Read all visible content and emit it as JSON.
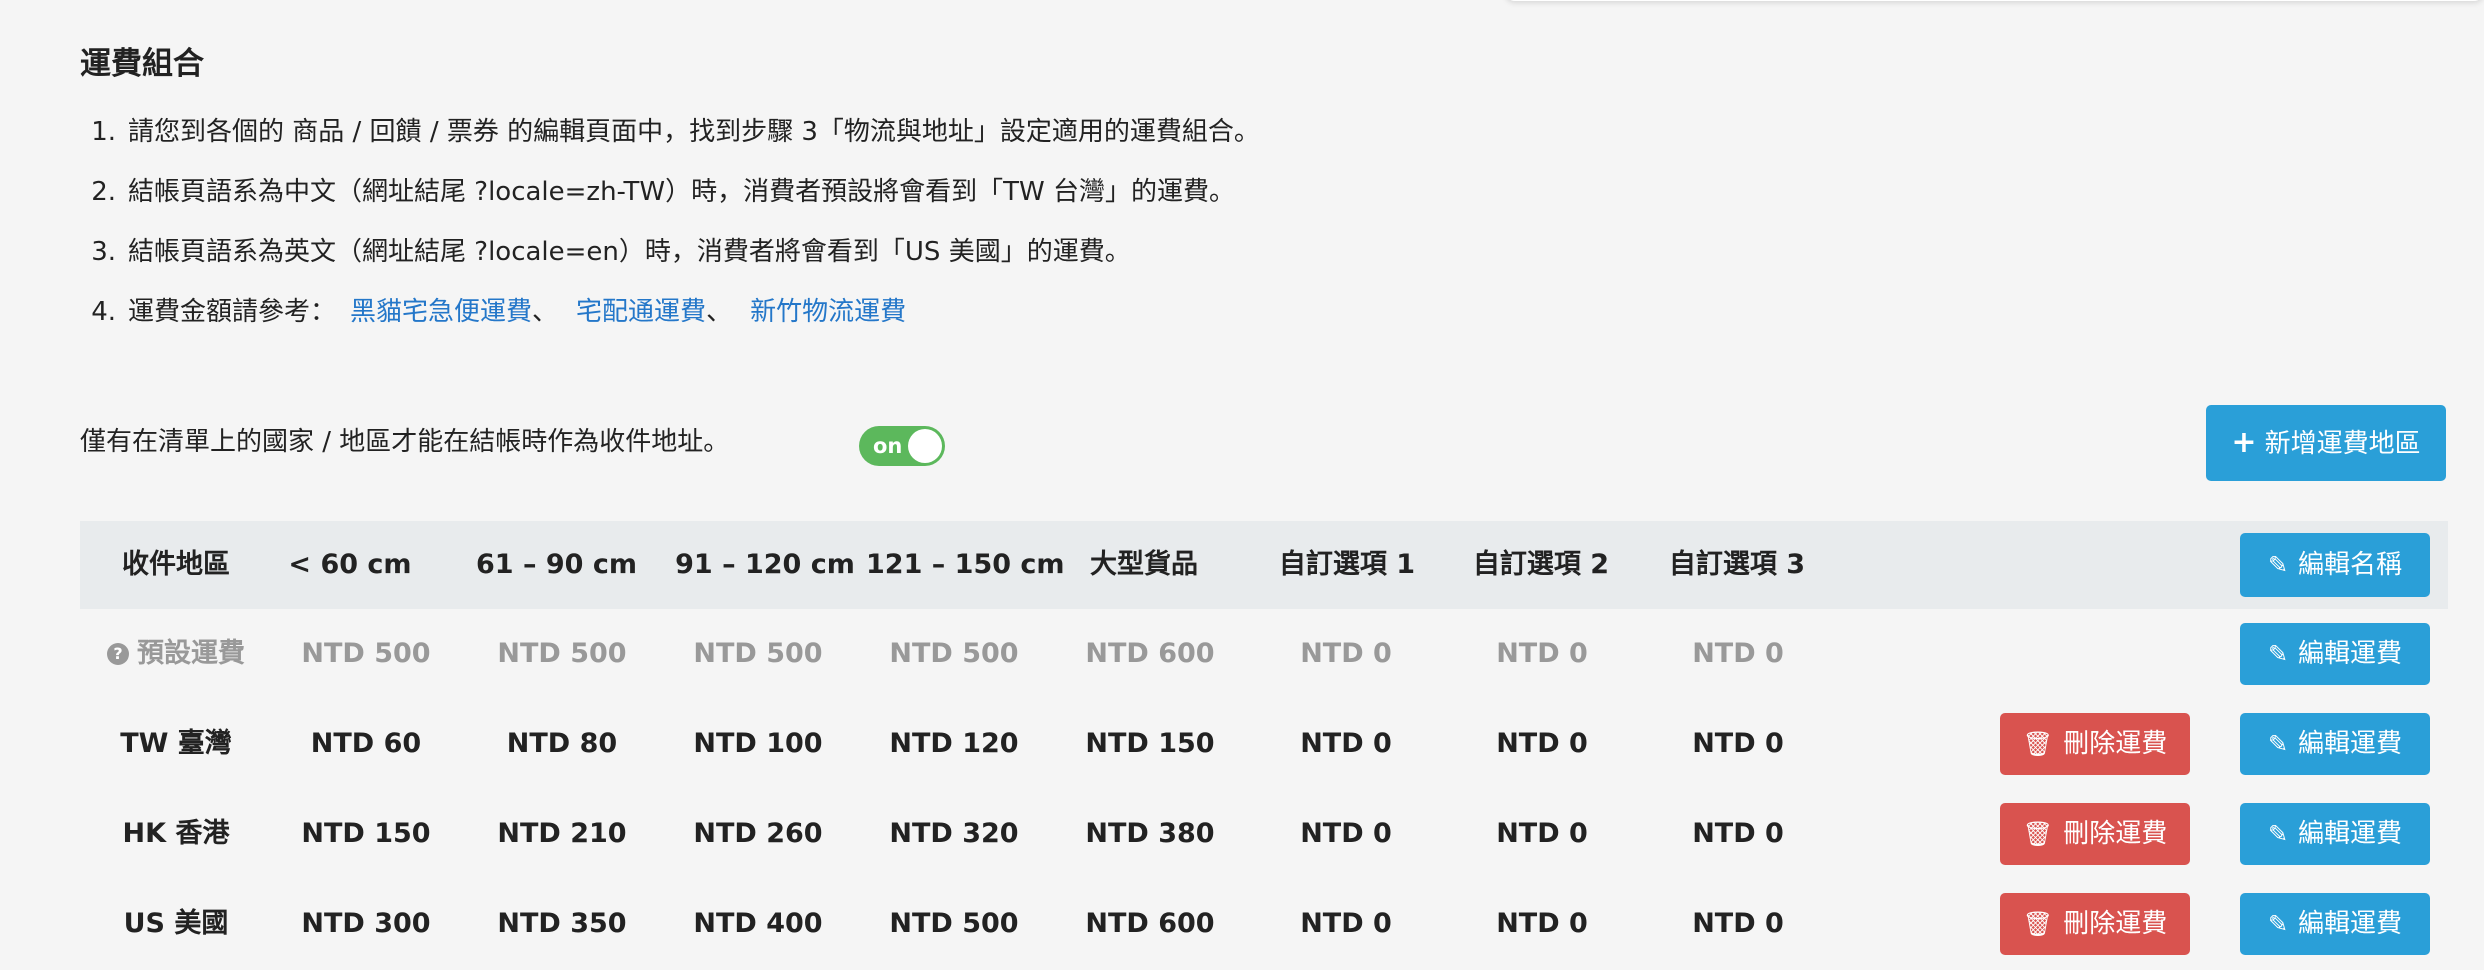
{
  "section": {
    "title": "運費組合",
    "instructions": [
      {
        "num": "1.",
        "text": "請您到各個的 商品 / 回饋 / 票券 的編輯頁面中，找到步驟 3「物流與地址」設定適用的運費組合。"
      },
      {
        "num": "2.",
        "text": "結帳頁語系為中文（網址結尾 ?locale=zh-TW）時，消費者預設將會看到「TW 台灣」的運費。"
      },
      {
        "num": "3.",
        "text": "結帳頁語系為英文（網址結尾 ?locale=en）時，消費者將會看到「US 美國」的運費。"
      }
    ],
    "reference": {
      "num": "4.",
      "prefix": "運費金額請參考：",
      "links": [
        "黑貓宅急便運費",
        "宅配通運費",
        "新竹物流運費"
      ],
      "separator": "、"
    }
  },
  "restriction": {
    "text": "僅有在清單上的國家 / 地區才能在結帳時作為收件地址。",
    "toggle_label": "on",
    "toggle_state": "on",
    "toggle_color": "#5cb85c"
  },
  "add_region_button": {
    "icon": "plus-icon",
    "label": "新增運費地區"
  },
  "table": {
    "headers": [
      "收件地區",
      "< 60 cm",
      "61 – 90 cm",
      "91 – 120 cm",
      "121 – 150 cm",
      "大型貨品",
      "自訂選項 1",
      "自訂選項 2",
      "自訂選項 3"
    ],
    "edit_names_label": "編輯名稱",
    "edit_fee_label": "編輯運費",
    "delete_fee_label": "刪除運費",
    "default_row": {
      "region": "預設運費",
      "icon": "question-circle-icon",
      "values": [
        "NTD 500",
        "NTD 500",
        "NTD 500",
        "NTD 500",
        "NTD 600",
        "NTD 0",
        "NTD 0",
        "NTD 0"
      ]
    },
    "rows": [
      {
        "region": "TW 臺灣",
        "values": [
          "NTD 60",
          "NTD 80",
          "NTD 100",
          "NTD 120",
          "NTD 150",
          "NTD 0",
          "NTD 0",
          "NTD 0"
        ]
      },
      {
        "region": "HK 香港",
        "values": [
          "NTD 150",
          "NTD 210",
          "NTD 260",
          "NTD 320",
          "NTD 380",
          "NTD 0",
          "NTD 0",
          "NTD 0"
        ]
      },
      {
        "region": "US 美國",
        "values": [
          "NTD 300",
          "NTD 350",
          "NTD 400",
          "NTD 500",
          "NTD 600",
          "NTD 0",
          "NTD 0",
          "NTD 0"
        ]
      }
    ]
  },
  "colors": {
    "primary_button": "#2a9fd8",
    "danger_button": "#d9534f",
    "link": "#2477c9",
    "header_bg": "#e8ebed"
  }
}
